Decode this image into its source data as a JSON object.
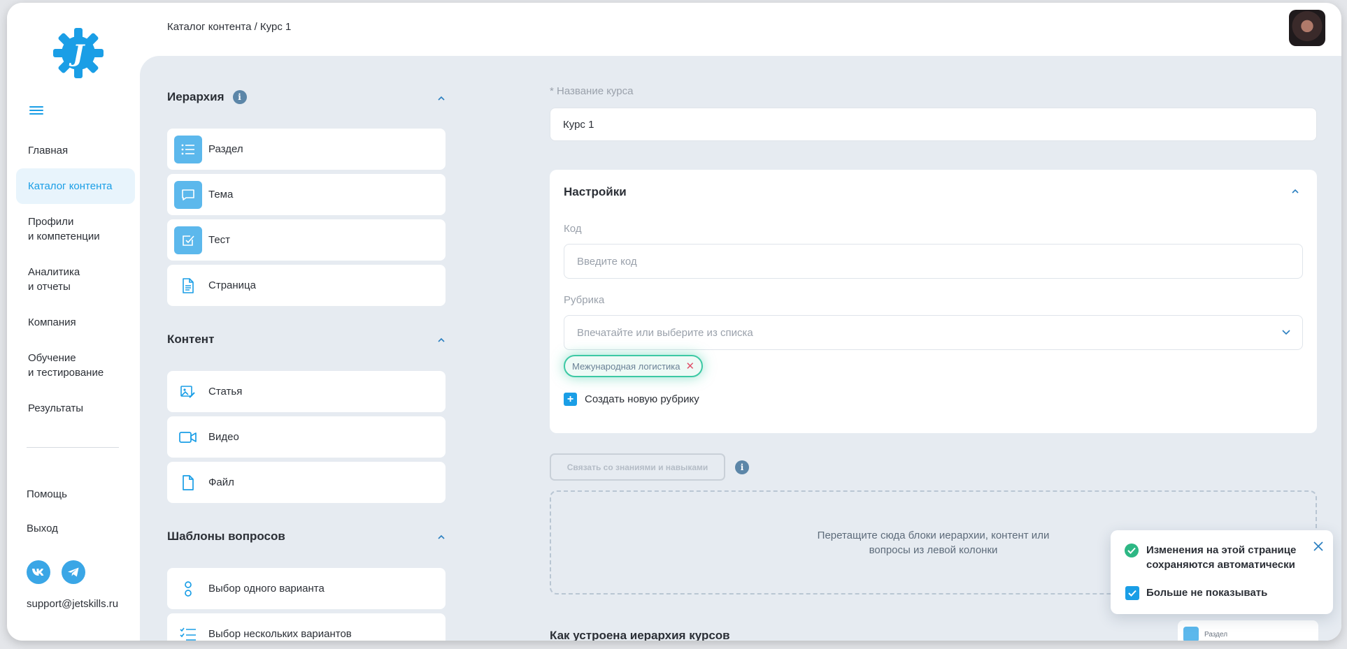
{
  "breadcrumb": "Каталог контента / Курс 1",
  "sidebar": {
    "items": [
      {
        "label": "Главная"
      },
      {
        "label": "Каталог контента"
      },
      {
        "label": "Профили\nи компетенции"
      },
      {
        "label": "Аналитика\nи отчеты"
      },
      {
        "label": "Компания"
      },
      {
        "label": "Обучение\nи тестирование"
      },
      {
        "label": "Результаты"
      }
    ],
    "help": "Помощь",
    "logout": "Выход",
    "support_email": "support@jetskills.ru"
  },
  "left_panel": {
    "hierarchy": {
      "title": "Иерархия",
      "items": [
        "Раздел",
        "Тема",
        "Тест",
        "Страница"
      ]
    },
    "content": {
      "title": "Контент",
      "items": [
        "Статья",
        "Видео",
        "Файл"
      ]
    },
    "templates": {
      "title": "Шаблоны вопросов",
      "items": [
        "Выбор одного варианта",
        "Выбор нескольких вариантов"
      ]
    }
  },
  "course_form": {
    "name_label": "* Название курса",
    "name_value": "Курс 1",
    "settings": {
      "title": "Настройки",
      "code_label": "Код",
      "code_placeholder": "Введите код",
      "rubric_label": "Рубрика",
      "rubric_placeholder": "Впечатайте или выберите из списка",
      "tag": "Межународная логистика",
      "create_rubric": "Создать новую рубрику"
    },
    "link_button": "Связать со знаниями и навыками",
    "dropzone_line1": "Перетащите сюда блоки иерархии, контент или",
    "dropzone_line2": "вопросы из левой колонки",
    "how_title": "Как устроена иерархия курсов",
    "preview_label": "Раздел"
  },
  "toast": {
    "message": "Изменения на этой странице сохраняются автоматически",
    "checkbox_label": "Больше не показывать"
  },
  "colors": {
    "accent": "#1a9ee6",
    "success": "#2db784",
    "tag_border": "#3cc9a4",
    "content_bg": "#e6ebf1"
  }
}
